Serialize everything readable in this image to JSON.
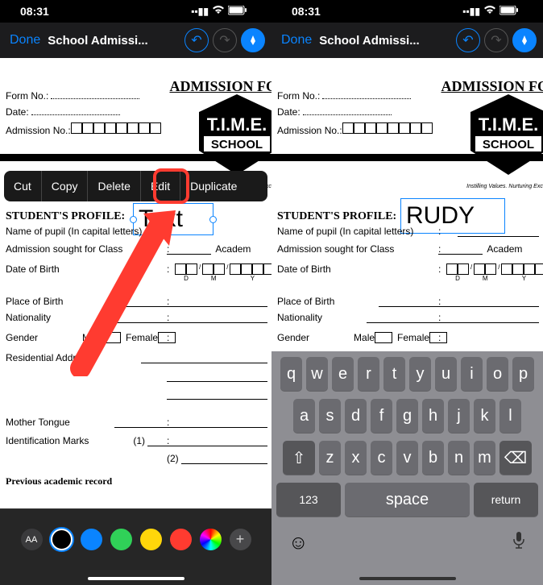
{
  "status": {
    "time": "08:31"
  },
  "toolbar": {
    "done": "Done",
    "title": "School Admissi..."
  },
  "context_menu": {
    "cut": "Cut",
    "copy": "Copy",
    "delete": "Delete",
    "edit": "Edit",
    "duplicate": "Duplicate"
  },
  "form": {
    "header": "ADMISSION FOR",
    "form_no": "Form No.:",
    "date": "Date:",
    "admission_no": "Admission No.:",
    "section_profile": "STUDENT'S PROFILE:",
    "name_pupil": "Name of pupil (In capital letters)",
    "admission_class": "Admission sought for Class",
    "academic": "Academ",
    "dob": "Date of Birth",
    "pob": "Place of Birth",
    "nationality": "Nationality",
    "gender": "Gender",
    "male": "Male",
    "female": "Female",
    "address": "Residential Address :",
    "mother_tongue": "Mother Tongue",
    "id_marks": "Identification Marks",
    "id1": "(1)",
    "id2": "(2)",
    "prev_record": "Previous academic record",
    "date_labels": {
      "d": "D",
      "m": "M",
      "y": "Y"
    }
  },
  "logo": {
    "brand": "T.I.M.E.",
    "sub": "SCHOOL",
    "tagline": "Instilling Values. Nurturing Exc"
  },
  "text_annotation": {
    "left": "Text",
    "right": "RUDY"
  },
  "keyboard": {
    "row1": [
      "q",
      "w",
      "e",
      "r",
      "t",
      "y",
      "u",
      "i",
      "o",
      "p"
    ],
    "row2": [
      "a",
      "s",
      "d",
      "f",
      "g",
      "h",
      "j",
      "k",
      "l"
    ],
    "row3": [
      "z",
      "x",
      "c",
      "v",
      "b",
      "n",
      "m"
    ],
    "num": "123",
    "space": "space",
    "return": "return"
  },
  "palette": {
    "aa": "AA"
  }
}
